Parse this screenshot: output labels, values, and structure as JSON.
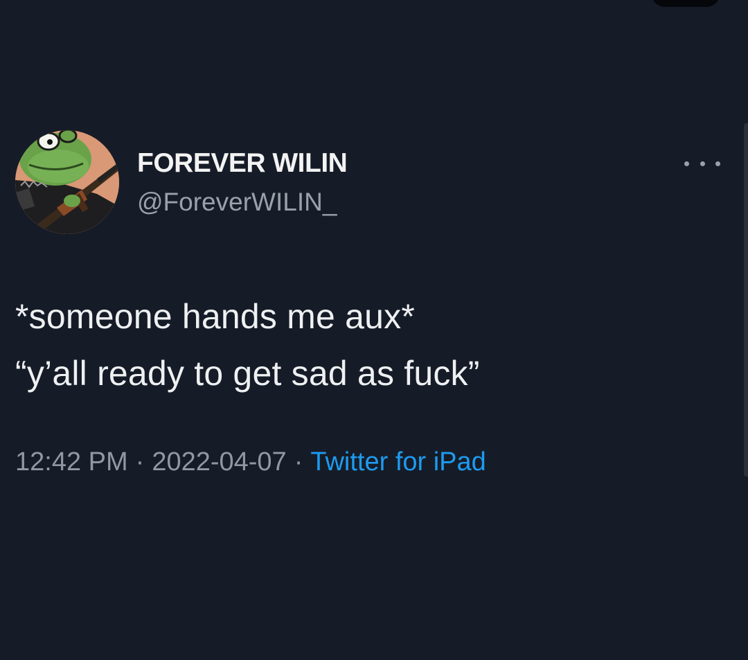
{
  "tweet": {
    "author": {
      "name": "FOREVER WILIN",
      "handle": "@ForeverWILIN_"
    },
    "text_lines": [
      "*someone hands me aux*",
      "“y’all ready to get sad as fuck”"
    ],
    "time": "12:42 PM",
    "date": "2022-04-07",
    "separator": "·",
    "source": "Twitter for iPad",
    "more_icon": "more-horizontal-icon",
    "avatar_icon": "frog-with-rifle-avatar"
  },
  "colors": {
    "background": "#161c27",
    "primary_text": "#eef0f2",
    "secondary_text": "#9aa1aa",
    "link": "#1d9bf0"
  }
}
